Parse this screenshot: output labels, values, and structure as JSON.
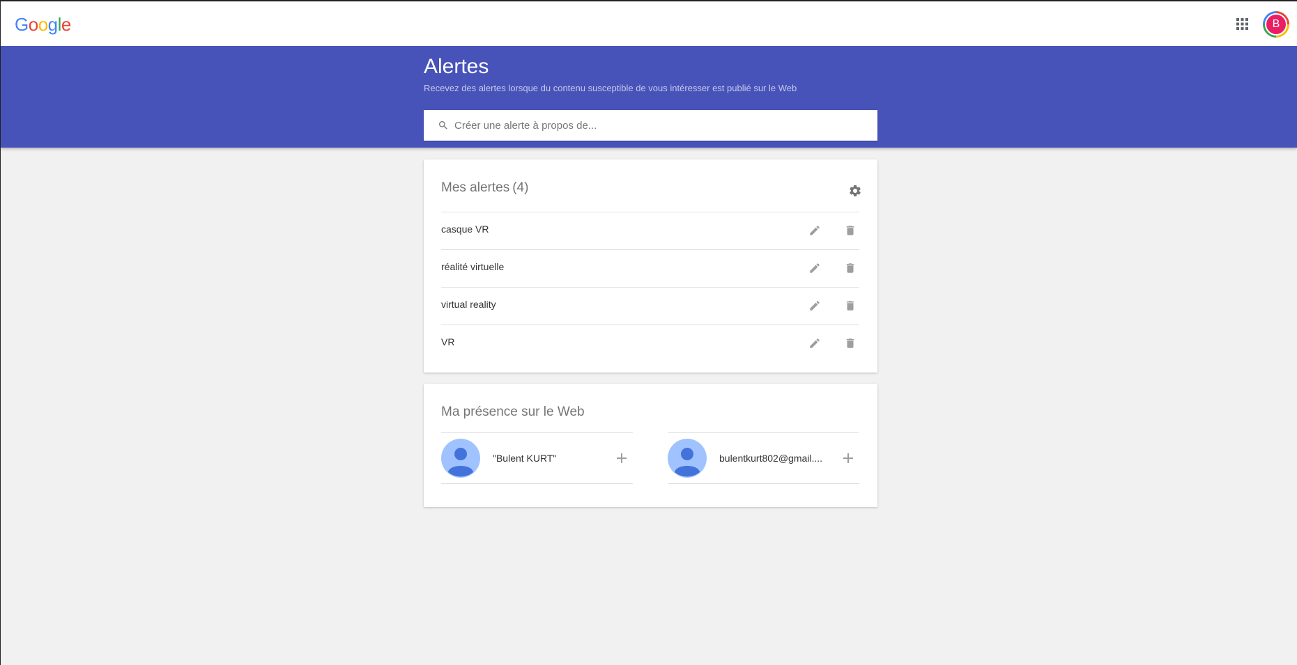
{
  "topbar": {
    "logo_letters": [
      "G",
      "o",
      "o",
      "g",
      "l",
      "e"
    ],
    "apps_icon": "apps-grid-icon",
    "avatar_initial": "B"
  },
  "hero": {
    "title": "Alertes",
    "subtitle": "Recevez des alertes lorsque du contenu susceptible de vous intéresser est publié sur le Web",
    "search_placeholder": "Créer une alerte à propos de...",
    "search_value": ""
  },
  "alerts_card": {
    "title": "Mes alertes",
    "count": "(4)",
    "settings_icon": "gear-icon",
    "items": [
      {
        "label": "casque VR"
      },
      {
        "label": "réalité virtuelle"
      },
      {
        "label": "virtual reality"
      },
      {
        "label": "VR"
      }
    ]
  },
  "presence_card": {
    "title": "Ma présence sur le Web",
    "items": [
      {
        "label": "\"Bulent KURT\""
      },
      {
        "label": "bulentkurt802@gmail...."
      }
    ]
  },
  "colors": {
    "hero_bg": "#4753b9",
    "page_bg": "#f1f1f1",
    "avatar_bg": "#e91e63",
    "icon_grey": "#9e9e9e"
  }
}
